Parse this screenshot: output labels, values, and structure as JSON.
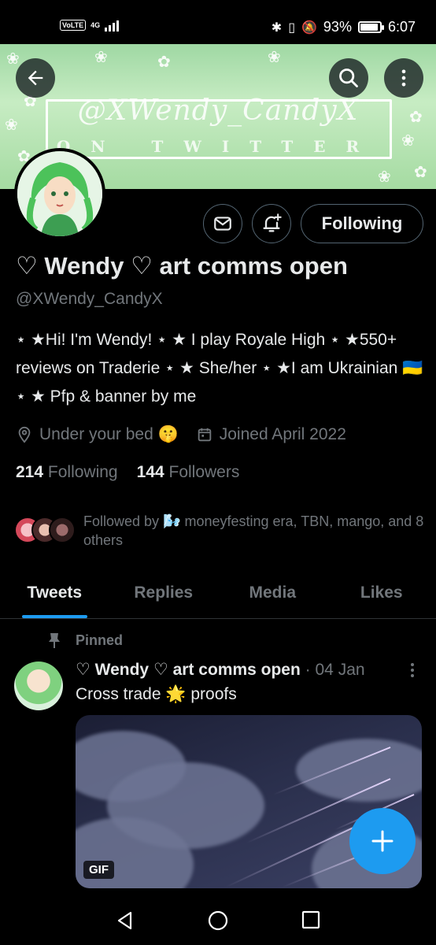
{
  "status_bar": {
    "volte": "VoLTE",
    "network": "4G",
    "battery_percent": "93%",
    "battery_level": 0.93,
    "time": "6:07"
  },
  "banner": {
    "title": "@XWendy_CandyX",
    "subtitle": "ON TWITTER"
  },
  "profile": {
    "name": "♡ Wendy ♡ art comms open",
    "handle": "@XWendy_CandyX",
    "bio": "⋆ ★Hi! I'm Wendy! ⋆ ★ I play Royale High ⋆ ★550+ reviews on Traderie ⋆ ★ She/her ⋆ ★I am Ukrainian 🇺🇦 ⋆ ★ Pfp & banner by me",
    "location": "Under your bed 🤫",
    "joined": "Joined April 2022",
    "following_count": "214",
    "following_label": "Following",
    "followers_count": "144",
    "followers_label": "Followers",
    "followed_by": "Followed by 🌬️ moneyfesting era, TBN, mango, and 8 others"
  },
  "actions": {
    "follow_label": "Following"
  },
  "tabs": [
    {
      "label": "Tweets"
    },
    {
      "label": "Replies"
    },
    {
      "label": "Media"
    },
    {
      "label": "Likes"
    }
  ],
  "tweet": {
    "pinned_label": "Pinned",
    "author": "♡ Wendy ♡ art comms open",
    "date": "· 04 Jan",
    "text": "Cross trade 🌟 proofs",
    "media_badge": "GIF"
  },
  "fab": {
    "icon": "plus-icon",
    "color": "#1d9bf0"
  }
}
